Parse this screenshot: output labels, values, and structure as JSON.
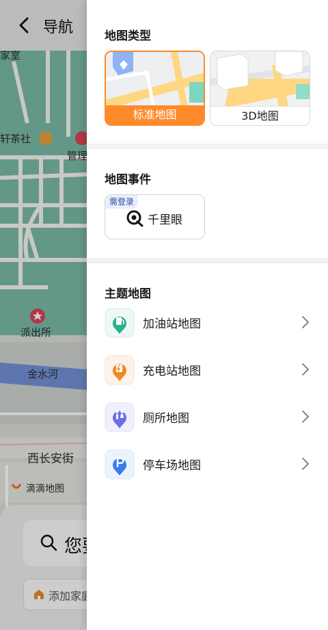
{
  "header": {
    "title": "导航"
  },
  "map": {
    "labels": {
      "shi": "家室",
      "teahouse": "轩茶社",
      "management": "管理",
      "police": "派出所",
      "river": "金水河",
      "street": "西长安街",
      "didi": "滴滴地图"
    }
  },
  "search": {
    "text": "您要",
    "home_chip": "添加家庭"
  },
  "panel": {
    "map_type_title": "地图类型",
    "map_types": [
      {
        "label": "标准地图",
        "selected": true
      },
      {
        "label": "3D地图",
        "selected": false
      }
    ],
    "map_event_title": "地图事件",
    "event": {
      "badge": "需登录",
      "label": "千里眼"
    },
    "theme_title": "主题地图",
    "themes": [
      {
        "label": "加油站地图",
        "icon": "gas-station-icon",
        "color": "#27b28a"
      },
      {
        "label": "充电站地图",
        "icon": "charging-station-icon",
        "color": "#f08a24"
      },
      {
        "label": "厕所地图",
        "icon": "toilet-icon",
        "color": "#6b6fe6"
      },
      {
        "label": "停车场地图",
        "icon": "parking-icon",
        "color": "#3a7bea"
      }
    ]
  },
  "colors": {
    "accent": "#ff8a2c",
    "park_green": "#6fb5a0",
    "river_blue": "#6c8bd6"
  }
}
